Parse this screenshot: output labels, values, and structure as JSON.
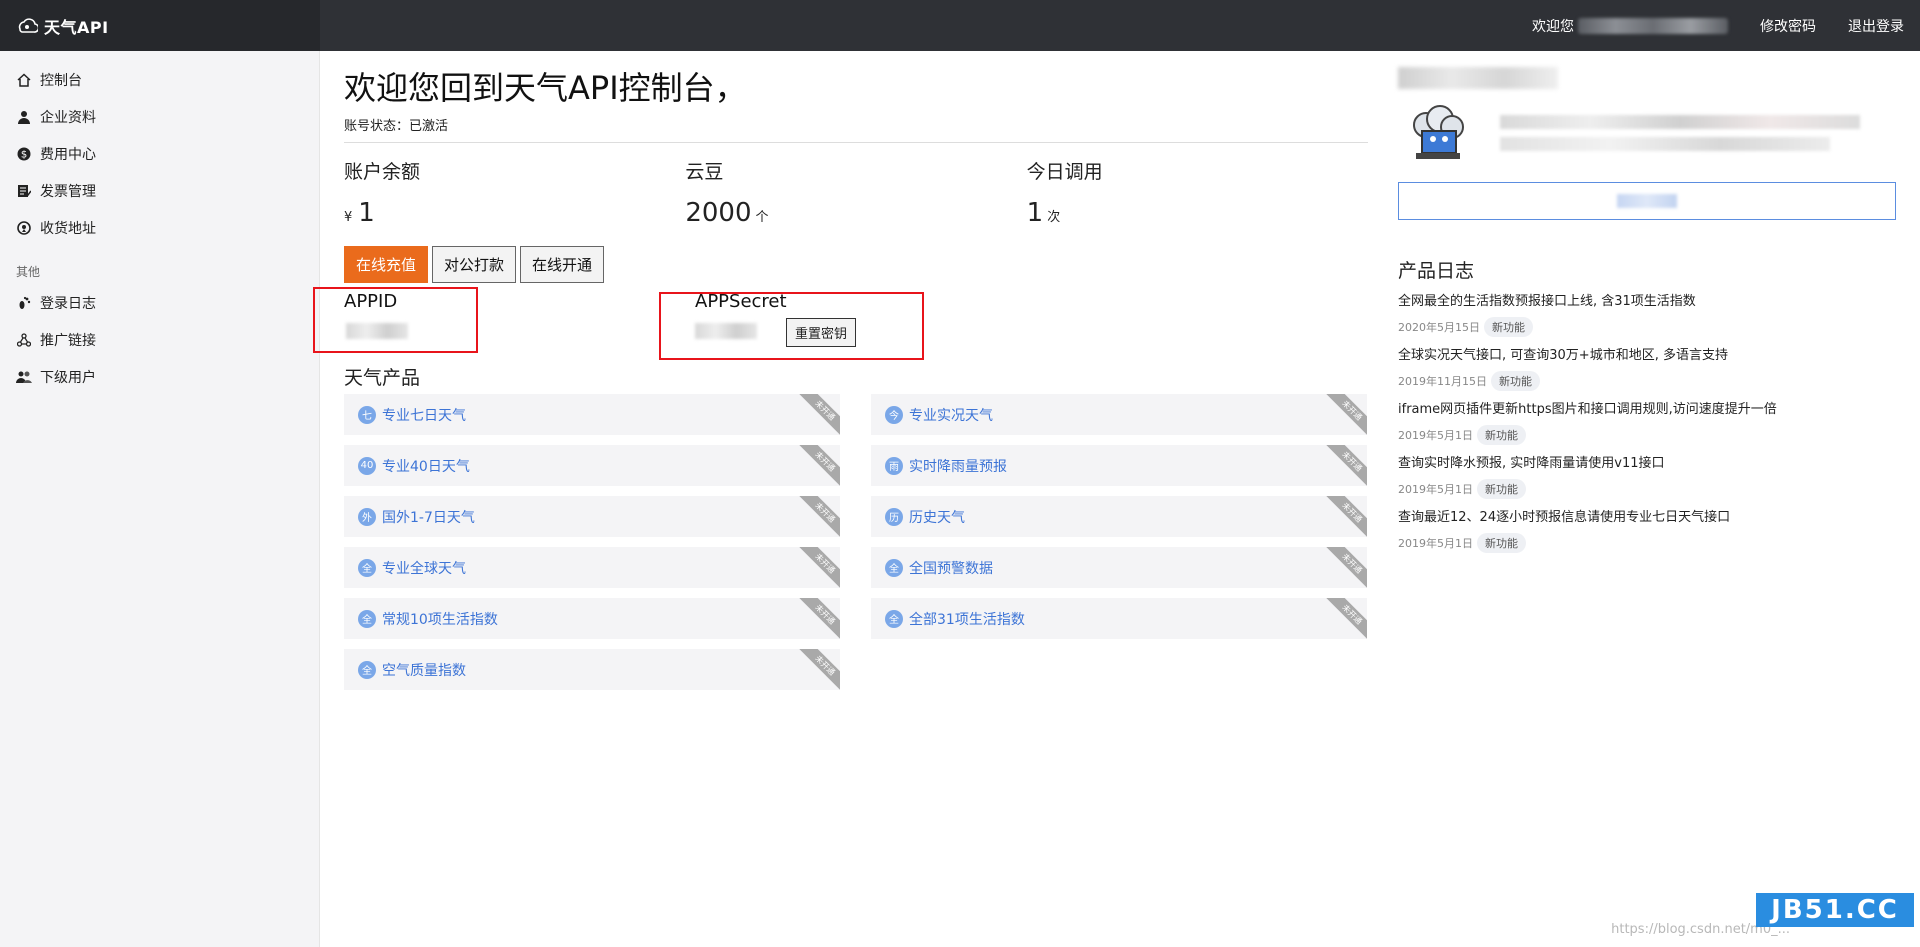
{
  "header": {
    "logo_text": "天气API",
    "welcome_prefix": "欢迎您",
    "change_password": "修改密码",
    "logout": "退出登录"
  },
  "sidebar": {
    "items": [
      {
        "label": "控制台",
        "icon": "home-icon"
      },
      {
        "label": "企业资料",
        "icon": "user-icon"
      },
      {
        "label": "费用中心",
        "icon": "dollar-icon"
      },
      {
        "label": "发票管理",
        "icon": "invoice-icon"
      },
      {
        "label": "收货地址",
        "icon": "location-icon"
      }
    ],
    "group_label": "其他",
    "other_items": [
      {
        "label": "登录日志",
        "icon": "footprint-icon"
      },
      {
        "label": "推广链接",
        "icon": "share-icon"
      },
      {
        "label": "下级用户",
        "icon": "users-icon"
      }
    ]
  },
  "main": {
    "welcome": "欢迎您回到天气API控制台，",
    "status": "账号状态：已激活",
    "stats": [
      {
        "label": "账户余额",
        "prefix": "¥",
        "value": "1",
        "unit": ""
      },
      {
        "label": "云豆",
        "prefix": "",
        "value": "2000",
        "unit": "个"
      },
      {
        "label": "今日调用",
        "prefix": "",
        "value": "1",
        "unit": "次"
      }
    ],
    "buttons": [
      "在线充值",
      "对公打款",
      "在线开通"
    ],
    "appid_label": "APPID",
    "appsecret_label": "APPSecret",
    "reset_secret": "重置密钥",
    "products_title": "天气产品",
    "ribbon_text": "未开通",
    "products": [
      {
        "badge": "七",
        "name": "专业七日天气"
      },
      {
        "badge": "今",
        "name": "专业实况天气"
      },
      {
        "badge": "40",
        "name": "专业40日天气"
      },
      {
        "badge": "雨",
        "name": "实时降雨量预报"
      },
      {
        "badge": "外",
        "name": "国外1-7日天气"
      },
      {
        "badge": "历",
        "name": "历史天气"
      },
      {
        "badge": "全",
        "name": "专业全球天气"
      },
      {
        "badge": "全",
        "name": "全国预警数据"
      },
      {
        "badge": "全",
        "name": "常规10项生活指数"
      },
      {
        "badge": "全",
        "name": "全部31项生活指数"
      },
      {
        "badge": "全",
        "name": "空气质量指数"
      }
    ]
  },
  "right": {
    "log_title": "产品日志",
    "logs": [
      {
        "text": "全网最全的生活指数预报接口上线, 含31项生活指数",
        "date": "2020年5月15日",
        "tag": "新功能"
      },
      {
        "text": "全球实况天气接口, 可查询30万+城市和地区, 多语言支持",
        "date": "2019年11月15日",
        "tag": "新功能"
      },
      {
        "text": "iframe网页插件更新https图片和接口调用规则,访问速度提升一倍",
        "date": "2019年5月1日",
        "tag": "新功能"
      },
      {
        "text": "查询实时降水预报, 实时降雨量请使用v11接口",
        "date": "2019年5月1日",
        "tag": "新功能"
      },
      {
        "text": "查询最近12、24逐小时预报信息请使用专业七日天气接口",
        "date": "2019年5月1日",
        "tag": "新功能"
      }
    ]
  },
  "watermark": {
    "logo": "JB51.CC",
    "url": "https://blog.csdn.net/m0_..."
  }
}
